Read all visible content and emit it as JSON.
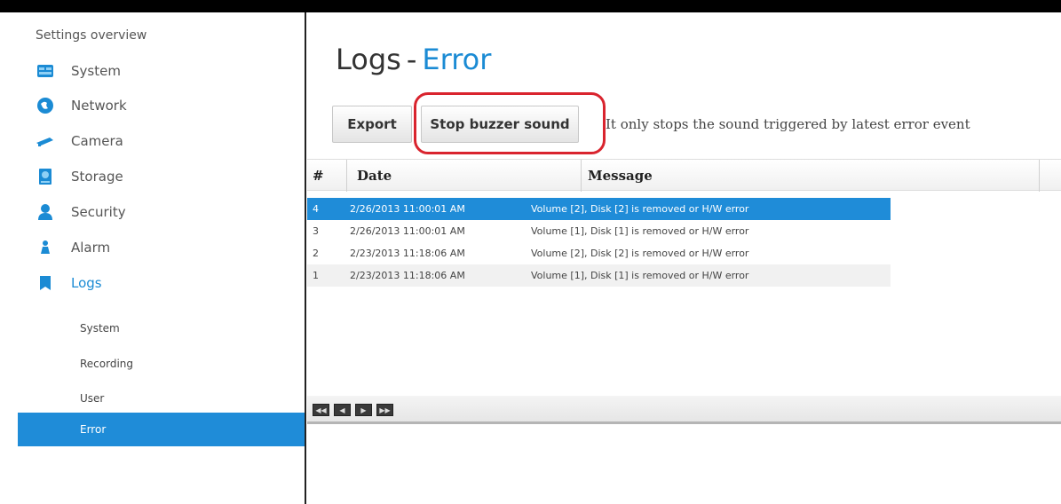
{
  "sidebar": {
    "title": "Settings overview",
    "items": [
      {
        "label": "System",
        "icon": "system-icon"
      },
      {
        "label": "Network",
        "icon": "network-icon"
      },
      {
        "label": "Camera",
        "icon": "camera-icon"
      },
      {
        "label": "Storage",
        "icon": "storage-icon"
      },
      {
        "label": "Security",
        "icon": "security-icon"
      },
      {
        "label": "Alarm",
        "icon": "alarm-icon"
      },
      {
        "label": "Logs",
        "icon": "logs-icon"
      }
    ],
    "subitems": [
      {
        "label": "System"
      },
      {
        "label": "Recording"
      },
      {
        "label": "User"
      },
      {
        "label": "Error"
      }
    ]
  },
  "header": {
    "title_prefix": "Logs",
    "separator": "-",
    "title_accent": "Error"
  },
  "toolbar": {
    "export_label": "Export",
    "stop_label": "Stop buzzer sound",
    "hint": "It only stops the sound triggered by latest error event"
  },
  "table": {
    "columns": [
      "#",
      "Date",
      "Message"
    ],
    "rows": [
      {
        "num": "4",
        "date": "2/26/2013 11:00:01 AM",
        "message": "Volume [2], Disk [2] is removed or H/W error"
      },
      {
        "num": "3",
        "date": "2/26/2013 11:00:01 AM",
        "message": "Volume [1], Disk [1] is removed or H/W error"
      },
      {
        "num": "2",
        "date": "2/23/2013 11:18:06 AM",
        "message": "Volume [2], Disk [2] is removed or H/W error"
      },
      {
        "num": "1",
        "date": "2/23/2013 11:18:06 AM",
        "message": "Volume [1], Disk [1] is removed or H/W error"
      }
    ]
  },
  "pager": {
    "buttons": [
      "first-page-icon",
      "prev-page-icon",
      "next-page-icon",
      "last-page-icon"
    ]
  },
  "colors": {
    "accent": "#1b8bd4",
    "selection": "#1f8cd8",
    "highlight_ring": "#d9242e"
  }
}
